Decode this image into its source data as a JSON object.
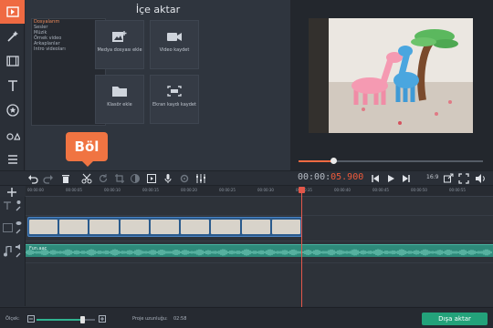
{
  "import": {
    "title": "İçe aktar",
    "categories": [
      "Dosyalarım",
      "Sesler",
      "Müzik",
      "Örnek video",
      "Arkaplanlar",
      "Intro videoları"
    ],
    "tiles": [
      {
        "label": "Medya dosyası ekle",
        "icon": "media-add-icon"
      },
      {
        "label": "Video kaydet",
        "icon": "camera-icon"
      },
      {
        "label": "Klasör ekle",
        "icon": "folder-icon"
      },
      {
        "label": "Ekran kaydı kaydet",
        "icon": "screen-capture-icon"
      }
    ]
  },
  "player": {
    "timecode_prefix": "00:00:",
    "timecode_rest": "05.900",
    "aspect_ratio": "16:9",
    "progress": 0.19
  },
  "tooltip": {
    "label": "Böl"
  },
  "ruler": {
    "ticks": [
      "00:00:00",
      "00:00:05",
      "00:00:10",
      "00:00:15",
      "00:00:20",
      "00:00:25",
      "00:00:30",
      "00:00:35",
      "00:00:40",
      "00:00:45",
      "00:00:50",
      "00:00:55",
      "00:01:00"
    ]
  },
  "audio": {
    "label": "Fun.aac"
  },
  "bottom": {
    "zoom_label": "Ölçek:",
    "zoom_level": 0.78,
    "duration_label": "Proje uzunluğu:",
    "duration_value": "02:58",
    "export_label": "Dışa aktar"
  },
  "colors": {
    "accent": "#ef6a42",
    "green": "#23a27a",
    "clip_blue": "#2a5a8c",
    "audio_teal": "#2e8a7a"
  }
}
